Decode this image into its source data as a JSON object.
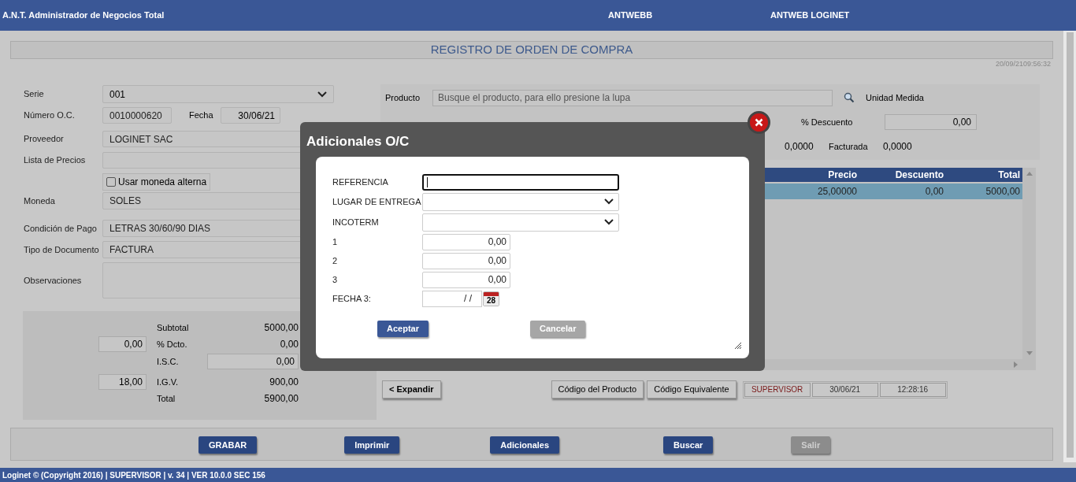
{
  "app_bar": {
    "title": "A.N.T. Administrador de Negocios Total",
    "database": "ANTWEBB",
    "company": "ANTWEB LOGINET"
  },
  "page_title": "REGISTRO DE ORDEN DE COMPRA",
  "timestamp": "20/09/2109:56:32",
  "form": {
    "serie": {
      "label": "Serie",
      "value": "001"
    },
    "numero": {
      "label": "Número O.C.",
      "value": "0010000620"
    },
    "fecha": {
      "label": "Fecha",
      "value": "30/06/21"
    },
    "proveedor": {
      "label": "Proveedor",
      "value": "LOGINET SAC"
    },
    "lista_precios": {
      "label": "Lista de Precios"
    },
    "moneda_alterna": {
      "label": "Usar moneda alterna",
      "checked": false
    },
    "moneda": {
      "label": "Moneda",
      "value": "SOLES"
    },
    "condicion_pago": {
      "label": "Condición de Pago",
      "value": "LETRAS 30/60/90 DIAS"
    },
    "tipo_documento": {
      "label": "Tipo de Documento",
      "value": "FACTURA"
    },
    "observaciones": {
      "label": "Observaciones"
    }
  },
  "totals": {
    "subtotal": {
      "label": "Subtotal",
      "value": "5000,00"
    },
    "dcto": {
      "input": "0,00",
      "label": "% Dcto.",
      "value": "0,00"
    },
    "isc": {
      "label": "I.S.C.",
      "value": "0,00"
    },
    "igv": {
      "input": "18,00",
      "label": "I.G.V.",
      "value": "900,00"
    },
    "total": {
      "label": "Total",
      "value": "5900,00"
    }
  },
  "product": {
    "label": "Producto",
    "placeholder": "Busque el producto, para ello presione la lupa",
    "unit_label": "Unidad Medida",
    "descuento": {
      "label": "% Descuento",
      "value": "0,00"
    },
    "stock_1": "0,0000",
    "facturada": {
      "label": "Facturada",
      "value": "0,0000"
    }
  },
  "table": {
    "columns": [
      "Precio",
      "Descuento",
      "Total"
    ],
    "rows": [
      {
        "cells": [
          "25,00000",
          "0,00",
          "5000,00"
        ],
        "selected": true
      }
    ]
  },
  "expand_button": "< Expandir",
  "code_buttons": [
    "Código del Producto",
    "Código Equivalente"
  ],
  "status": {
    "user": "SUPERVISOR",
    "date": "30/06/21",
    "time": "12:28:16"
  },
  "actions": [
    {
      "label": "GRABAR",
      "disabled": false
    },
    {
      "label": "Imprimir",
      "disabled": false
    },
    {
      "label": "Adicionales",
      "disabled": false
    },
    {
      "label": "Buscar",
      "disabled": false
    },
    {
      "label": "Salir",
      "disabled": true
    }
  ],
  "footer": "Loginet © (Copyright 2016) | SUPERVISOR | v. 34 | VER 10.0.0 SEC 156",
  "dialog": {
    "title": "Adicionales O/C",
    "fields": [
      {
        "kind": "text",
        "label": "REFERENCIA"
      },
      {
        "kind": "select",
        "label": "LUGAR DE ENTREGA"
      },
      {
        "kind": "select",
        "label": "INCOTERM"
      },
      {
        "kind": "number",
        "label": "1",
        "value": "0,00"
      },
      {
        "kind": "number",
        "label": "2",
        "value": "0,00"
      },
      {
        "kind": "number",
        "label": "3",
        "value": "0,00"
      },
      {
        "kind": "date",
        "label": "FECHA 3:",
        "value": "/ /",
        "badge": "28"
      }
    ],
    "accept": "Aceptar",
    "cancel": "Cancelar"
  }
}
